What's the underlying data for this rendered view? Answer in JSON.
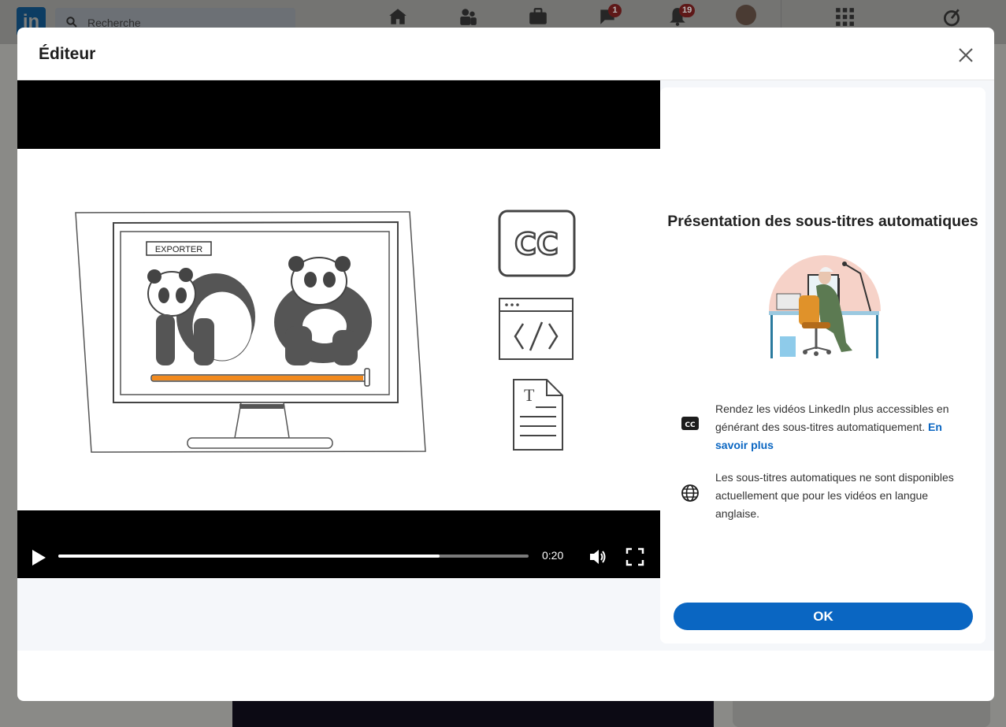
{
  "background": {
    "logo_text": "in",
    "search_placeholder": "Recherche",
    "messaging_badge": "1",
    "notifications_badge": "19"
  },
  "modal": {
    "title": "Éditeur",
    "video": {
      "frame_label": "EXPORTER",
      "time": "0:20",
      "progress_fraction": 0.81
    },
    "panel": {
      "title": "Présentation des sous-titres automatiques",
      "info1_text": "Rendez les vidéos LinkedIn plus accessibles en générant des sous-titres automatiquement. ",
      "info1_link": "En savoir plus",
      "info2_text": "Les sous-titres automatiques ne sont disponibles actuellement que pour les vidéos en langue anglaise.",
      "ok_label": "OK"
    }
  },
  "colors": {
    "accent": "#0a66c2",
    "progress_orange": "#f28a1e",
    "overlay": "#8a8a87"
  },
  "icons": [
    "search-icon",
    "home-icon",
    "network-icon",
    "jobs-icon",
    "messaging-icon",
    "notifications-icon",
    "apps-grid-icon",
    "premium-icon",
    "close-icon",
    "play-icon",
    "volume-icon",
    "fullscreen-icon",
    "closed-captions-icon",
    "globe-icon"
  ]
}
